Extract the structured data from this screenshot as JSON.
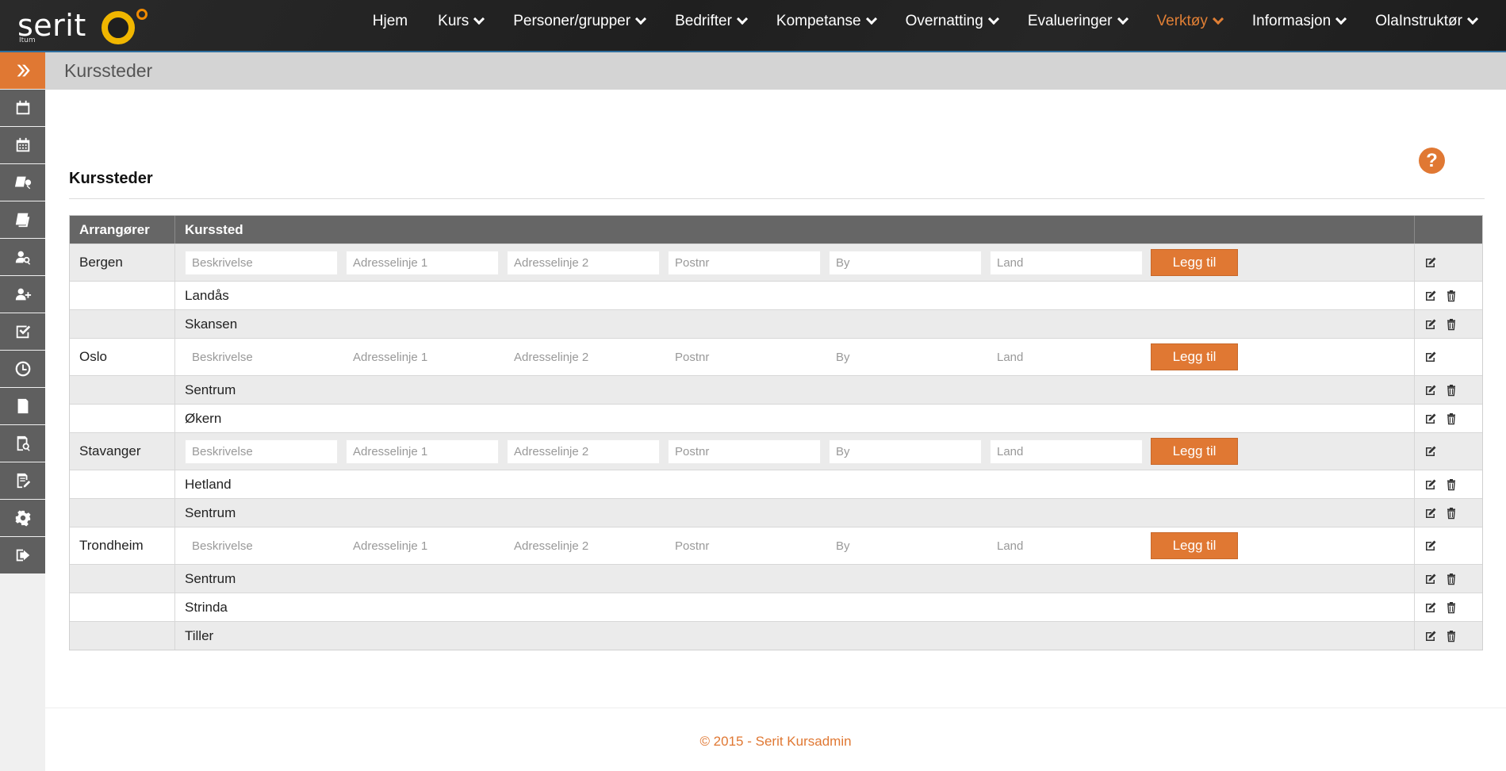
{
  "header": {
    "logo_text": "serit",
    "logo_sub": "Itum",
    "nav": [
      {
        "label": "Hjem",
        "dropdown": false,
        "active": false
      },
      {
        "label": "Kurs",
        "dropdown": true,
        "active": false
      },
      {
        "label": "Personer/grupper",
        "dropdown": true,
        "active": false
      },
      {
        "label": "Bedrifter",
        "dropdown": true,
        "active": false
      },
      {
        "label": "Kompetanse",
        "dropdown": true,
        "active": false
      },
      {
        "label": "Overnatting",
        "dropdown": true,
        "active": false
      },
      {
        "label": "Evalueringer",
        "dropdown": true,
        "active": false
      },
      {
        "label": "Verktøy",
        "dropdown": true,
        "active": true
      },
      {
        "label": "Informasjon",
        "dropdown": true,
        "active": false
      },
      {
        "label": "OlaInstruktør",
        "dropdown": true,
        "active": false
      }
    ]
  },
  "sidebar": {
    "items": [
      {
        "icon": "double-chevron-right-icon"
      },
      {
        "icon": "calendar-icon"
      },
      {
        "icon": "calendar-grid-icon"
      },
      {
        "icon": "course-search-icon"
      },
      {
        "icon": "course-list-icon"
      },
      {
        "icon": "person-search-icon"
      },
      {
        "icon": "person-add-icon"
      },
      {
        "icon": "checkbox-icon"
      },
      {
        "icon": "clock-icon"
      },
      {
        "icon": "document-icon"
      },
      {
        "icon": "document-search-icon"
      },
      {
        "icon": "document-edit-icon"
      },
      {
        "icon": "gear-icon"
      },
      {
        "icon": "sign-out-icon"
      }
    ]
  },
  "page": {
    "header_title": "Kurssteder",
    "section_title": "Kurssteder",
    "help_label": "?"
  },
  "table": {
    "columns": [
      "Arrangører",
      "Kurssted"
    ],
    "placeholders": {
      "beskrivelse": "Beskrivelse",
      "adresse1": "Adresselinje 1",
      "adresse2": "Adresselinje 2",
      "postnr": "Postnr",
      "by": "By",
      "land": "Land"
    },
    "add_label": "Legg til",
    "groups": [
      {
        "name": "Bergen",
        "inputs_filled": true,
        "places": [
          "Landås",
          "Skansen"
        ]
      },
      {
        "name": "Oslo",
        "inputs_filled": false,
        "places": [
          "Sentrum",
          "Økern"
        ]
      },
      {
        "name": "Stavanger",
        "inputs_filled": true,
        "places": [
          "Hetland",
          "Sentrum"
        ]
      },
      {
        "name": "Trondheim",
        "inputs_filled": false,
        "places": [
          "Sentrum",
          "Strinda",
          "Tiller"
        ]
      }
    ]
  },
  "footer": {
    "text": "© 2015 - Serit Kursadmin"
  },
  "colors": {
    "accent": "#e07833",
    "topbar": "#222222",
    "sidebar_button": "#5f5f5f",
    "table_header": "#666666",
    "row_alt": "#ebebeb"
  }
}
